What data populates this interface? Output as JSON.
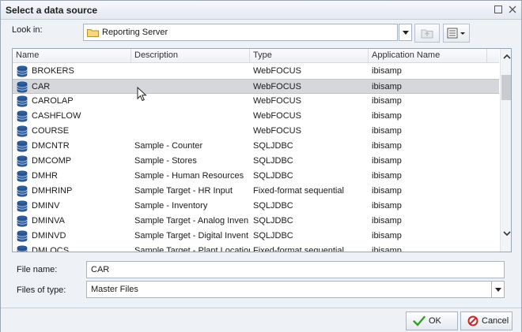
{
  "window": {
    "title": "Select a data source"
  },
  "look_in": {
    "label": "Look in:",
    "value": "Reporting Server"
  },
  "columns": [
    "Name",
    "Description",
    "Type",
    "Application Name"
  ],
  "rows": [
    {
      "name": "BROKERS",
      "description": "",
      "type": "WebFOCUS",
      "app": "ibisamp"
    },
    {
      "name": "CAR",
      "description": "",
      "type": "WebFOCUS",
      "app": "ibisamp"
    },
    {
      "name": "CAROLAP",
      "description": "",
      "type": "WebFOCUS",
      "app": "ibisamp"
    },
    {
      "name": "CASHFLOW",
      "description": "",
      "type": "WebFOCUS",
      "app": "ibisamp"
    },
    {
      "name": "COURSE",
      "description": "",
      "type": "WebFOCUS",
      "app": "ibisamp"
    },
    {
      "name": "DMCNTR",
      "description": "Sample - Counter",
      "type": "SQLJDBC",
      "app": "ibisamp"
    },
    {
      "name": "DMCOMP",
      "description": "Sample - Stores",
      "type": "SQLJDBC",
      "app": "ibisamp"
    },
    {
      "name": "DMHR",
      "description": "Sample - Human Resources",
      "type": "SQLJDBC",
      "app": "ibisamp"
    },
    {
      "name": "DMHRINP",
      "description": "Sample Target - HR Input",
      "type": "Fixed-format sequential",
      "app": "ibisamp"
    },
    {
      "name": "DMINV",
      "description": "Sample - Inventory",
      "type": "SQLJDBC",
      "app": "ibisamp"
    },
    {
      "name": "DMINVA",
      "description": "Sample Target - Analog Inven",
      "type": "SQLJDBC",
      "app": "ibisamp"
    },
    {
      "name": "DMINVD",
      "description": "Sample Target - Digital Invent",
      "type": "SQLJDBC",
      "app": "ibisamp"
    },
    {
      "name": "DMLOCS",
      "description": "Sample Target - Plant Location",
      "type": "Fixed-format sequential",
      "app": "ibisamp"
    }
  ],
  "selected_row": "CAR",
  "file_name": {
    "label": "File name:",
    "value": "CAR"
  },
  "files_of_type": {
    "label": "Files of type:",
    "value": "Master Files"
  },
  "buttons": {
    "ok": "OK",
    "cancel": "Cancel"
  },
  "colors": {
    "ok_check": "#3a9a2a",
    "cancel_icon": "#c62828",
    "table_icon": "#2f5f9e"
  }
}
